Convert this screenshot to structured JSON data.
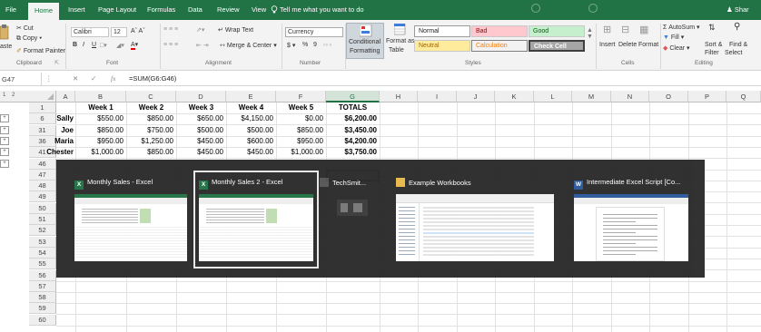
{
  "ribbon_tabs": [
    "File",
    "Home",
    "Insert",
    "Page Layout",
    "Formulas",
    "Data",
    "Review",
    "View"
  ],
  "tell_me": "Tell me what you want to do",
  "user": "Shar",
  "clipboard": {
    "paste": "aste",
    "cut": "Cut",
    "copy": "Copy",
    "format_painter": "Format Painter",
    "label": "Clipboard"
  },
  "font": {
    "name": "Calibri",
    "size": "12",
    "label": "Font",
    "bold": "B",
    "italic": "I",
    "underline": "U"
  },
  "alignment": {
    "wrap": "Wrap Text",
    "merge": "Merge & Center",
    "label": "Alignment"
  },
  "number": {
    "format": "Currency",
    "dollar": "$",
    "percent": "%",
    "comma": "9",
    "label": "Number"
  },
  "styles": {
    "conditional": "Conditional",
    "conditional2": "Formatting",
    "format_as": "Format as",
    "format_as2": "Table",
    "normal": "Normal",
    "bad": "Bad",
    "good": "Good",
    "neutral": "Neutral",
    "calculation": "Calculation",
    "check_cell": "Check Cell",
    "label": "Styles"
  },
  "cells": {
    "insert": "Insert",
    "delete": "Delete",
    "format": "Format",
    "label": "Cells"
  },
  "editing": {
    "autosum": "AutoSum",
    "fill": "Fill",
    "clear": "Clear",
    "sort": "Sort &",
    "sort2": "Filter",
    "find": "Find &",
    "find2": "Select",
    "label": "Editing"
  },
  "formula_bar": {
    "name_box": "G47",
    "fx": "fx",
    "formula": "=SUM(G6:G46)"
  },
  "columns": [
    "A",
    "B",
    "C",
    "D",
    "E",
    "F",
    "G",
    "H",
    "I",
    "J",
    "K",
    "L",
    "M",
    "N",
    "O",
    "P",
    "Q"
  ],
  "selected_column": "G",
  "rows": [
    "1",
    "6",
    "31",
    "36",
    "41",
    "46",
    "47",
    "48",
    "49",
    "50",
    "51",
    "52",
    "53",
    "54",
    "55",
    "56",
    "57",
    "58",
    "59",
    "60"
  ],
  "headers": [
    "Week 1",
    "Week 2",
    "Week 3",
    "Week 4",
    "Week 5",
    "TOTALS"
  ],
  "data_rows": [
    {
      "name": "Sally",
      "values": [
        "$550.00",
        "$850.00",
        "$650.00",
        "$4,150.00",
        "$0.00",
        "$6,200.00"
      ]
    },
    {
      "name": "Joe",
      "values": [
        "$850.00",
        "$750.00",
        "$500.00",
        "$500.00",
        "$850.00",
        "$3,450.00"
      ]
    },
    {
      "name": "Maria",
      "values": [
        "$950.00",
        "$1,250.00",
        "$450.00",
        "$600.00",
        "$950.00",
        "$4,200.00"
      ]
    },
    {
      "name": "Chester",
      "values": [
        "$1,000.00",
        "$850.00",
        "$450.00",
        "$450.00",
        "$1,000.00",
        "$3,750.00"
      ]
    }
  ],
  "switcher": {
    "windows": [
      {
        "title": "Monthly Sales - Excel",
        "app": "excel",
        "selected": false
      },
      {
        "title": "Monthly Sales 2 - Excel",
        "app": "excel",
        "selected": true
      },
      {
        "title": "TechSmit...",
        "app": "techsmith",
        "selected": false
      },
      {
        "title": "Example Workbooks",
        "app": "explorer",
        "selected": false
      },
      {
        "title": "Intermediate Excel Script [Co...",
        "app": "word",
        "selected": false
      }
    ]
  },
  "colors": {
    "excel_green": "#217346",
    "bad": "#ffc7ce",
    "good": "#c6efce",
    "neutral": "#ffeb9c",
    "check_cell": "#a5a5a5",
    "word_blue": "#2b579a"
  }
}
